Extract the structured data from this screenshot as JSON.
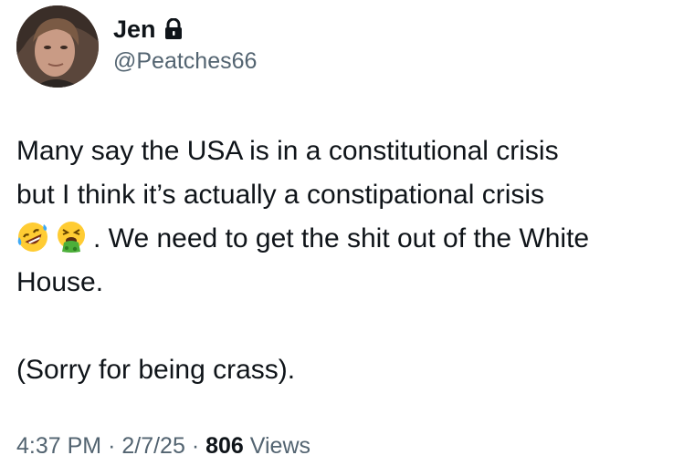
{
  "author": {
    "display_name": "Jen",
    "handle": "@Peatches66",
    "protected_icon": "lock-icon",
    "avatar": "profile-photo"
  },
  "tweet": {
    "line1": "Many say the USA is in a constitutional crisis",
    "line2": "but I think it’s actually a constipational crisis",
    "emoji1": "rolling-on-floor-laughing-emoji",
    "emoji2": "vomiting-face-emoji",
    "line3_rest": ". We need to get the shit out of the White",
    "line4": "House.",
    "paragraph2": "(Sorry for being crass)."
  },
  "meta": {
    "time": "4:37 PM",
    "separator": "·",
    "date": "2/7/25",
    "views_count": "806",
    "views_label": "Views"
  },
  "colors": {
    "text": "#0f1419",
    "secondary": "#536471",
    "background": "#ffffff"
  }
}
